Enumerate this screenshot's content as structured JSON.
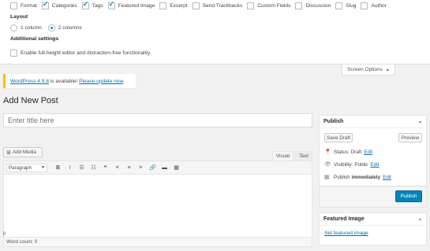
{
  "screen_options": {
    "boxes": [
      {
        "label": "Format",
        "checked": false
      },
      {
        "label": "Categories",
        "checked": true
      },
      {
        "label": "Tags",
        "checked": true
      },
      {
        "label": "Featured Image",
        "checked": true
      },
      {
        "label": "Excerpt",
        "checked": false
      },
      {
        "label": "Send Trackbacks",
        "checked": false
      },
      {
        "label": "Custom Fields",
        "checked": false
      },
      {
        "label": "Discussion",
        "checked": false
      },
      {
        "label": "Slug",
        "checked": false
      },
      {
        "label": "Author",
        "checked": false
      }
    ],
    "layout_heading": "Layout",
    "layout_one": "1 column",
    "layout_two": "2 columns",
    "layout_selected": "2 columns",
    "additional_heading": "Additional settings",
    "fullheight_label": "Enable full-height editor and distraction-free functionality.",
    "fullheight_checked": false,
    "tab_label": "Screen Options",
    "tab_arrow": "▲"
  },
  "notice": {
    "version_link": "WordPress 4.9.8",
    "middle": " is available! ",
    "update_link": "Please update now",
    "end": "."
  },
  "page_title": "Add New Post",
  "title_field": {
    "placeholder": "Enter title here",
    "value": ""
  },
  "editor": {
    "add_media": "Add Media",
    "add_media_icon": "media-icon",
    "tab_visual": "Visual",
    "tab_text": "Text",
    "format_select": "Paragraph",
    "toolbar_icons": [
      {
        "name": "bold-icon",
        "glyph": "B"
      },
      {
        "name": "italic-icon",
        "glyph": "I"
      },
      {
        "name": "bullet-list-icon",
        "glyph": "☰"
      },
      {
        "name": "numbered-list-icon",
        "glyph": "☷"
      },
      {
        "name": "blockquote-icon",
        "glyph": "❝"
      },
      {
        "name": "align-left-icon",
        "glyph": "⫷"
      },
      {
        "name": "align-center-icon",
        "glyph": "≡"
      },
      {
        "name": "align-right-icon",
        "glyph": "⫸"
      },
      {
        "name": "link-icon",
        "glyph": "🔗"
      },
      {
        "name": "read-more-icon",
        "glyph": "▬"
      },
      {
        "name": "toolbar-toggle-icon",
        "glyph": "▦"
      }
    ],
    "path": "p",
    "word_count": "Word count: 0"
  },
  "publish_box": {
    "title": "Publish",
    "save_draft": "Save Draft",
    "preview": "Preview",
    "status_label": "Status:",
    "status_value": "Draft",
    "visibility_label": "Visibility:",
    "visibility_value": "Public",
    "schedule_label": "Publish",
    "schedule_value": "immediately",
    "edit": "Edit",
    "publish_button": "Publish"
  },
  "featured_box": {
    "title": "Featured Image",
    "link": "Set featured image"
  },
  "colors": {
    "primary": "#0085ba",
    "link": "#0073aa",
    "notice": "#ffb900"
  }
}
